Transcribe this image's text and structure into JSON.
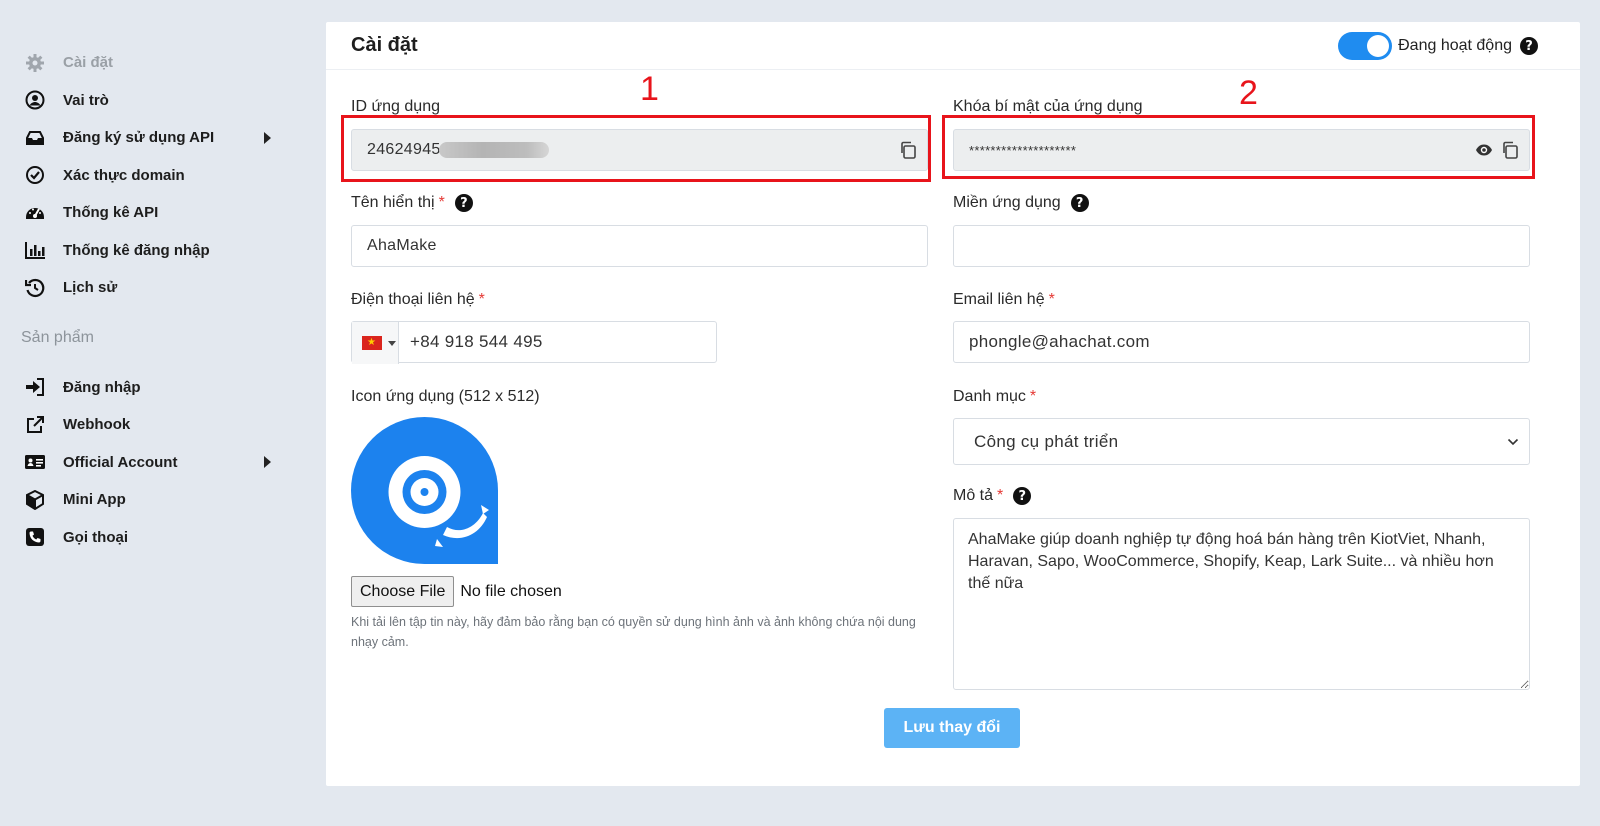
{
  "sidebar": {
    "items": [
      {
        "label": "Cài đặt",
        "icon": "gear-icon",
        "muted": true
      },
      {
        "label": "Vai trò",
        "icon": "user-circle-icon"
      },
      {
        "label": "Đăng ký sử dụng API",
        "icon": "inbox-icon",
        "has_submenu": true
      },
      {
        "label": "Xác thực domain",
        "icon": "check-circle-icon"
      },
      {
        "label": "Thống kê API",
        "icon": "gauge-icon"
      },
      {
        "label": "Thống kê đăng nhập",
        "icon": "bar-chart-icon"
      },
      {
        "label": "Lịch sử",
        "icon": "history-icon"
      }
    ],
    "section_label": "Sản phẩm",
    "product_items": [
      {
        "label": "Đăng nhập",
        "icon": "sign-in-icon"
      },
      {
        "label": "Webhook",
        "icon": "external-link-icon"
      },
      {
        "label": "Official Account",
        "icon": "id-card-icon",
        "has_submenu": true
      },
      {
        "label": "Mini App",
        "icon": "cube-icon"
      },
      {
        "label": "Gọi thoại",
        "icon": "phone-icon"
      }
    ]
  },
  "header": {
    "title": "Cài đặt",
    "status_label": "Đang hoạt động",
    "status_on": true
  },
  "form": {
    "app_id": {
      "label": "ID ứng dụng",
      "value": "24624945"
    },
    "secret_key": {
      "label": "Khóa bí mật của ứng dụng",
      "value": "********************"
    },
    "display_name": {
      "label": "Tên hiển thị",
      "required_mark": "*",
      "value": "AhaMake"
    },
    "app_domain": {
      "label": "Miền ứng dụng",
      "value": ""
    },
    "phone": {
      "label": "Điện thoại liên hệ",
      "required_mark": "*",
      "value": "+84 918 544 495",
      "flag": "★"
    },
    "email": {
      "label": "Email liên hệ",
      "required_mark": "*",
      "value": "phongle@ahachat.com"
    },
    "icon": {
      "label": "Icon ứng dụng (512 x 512)",
      "choose_file": "Choose File",
      "no_file": "No file chosen",
      "hint": "Khi tải lên tập tin này, hãy đảm bảo rằng bạn có quyền sử dụng hình ảnh và ảnh không chứa nội dung nhạy cảm."
    },
    "category": {
      "label": "Danh mục",
      "required_mark": "*",
      "value": "Công cụ phát triển"
    },
    "description": {
      "label": "Mô tả",
      "required_mark": "*",
      "value": "AhaMake giúp doanh nghiệp tự động hoá bán hàng trên KiotViet, Nhanh, Haravan, Sapo, WooCommerce, Shopify, Keap, Lark Suite... và nhiều hơn thế nữa"
    },
    "save_label": "Lưu thay đổi"
  },
  "annotations": {
    "box1": "1",
    "box2": "2"
  },
  "colors": {
    "primary": "#1f8cf0",
    "annotation": "#e8141b",
    "save_button": "#5cb3f5",
    "background": "#e3e8ef"
  }
}
